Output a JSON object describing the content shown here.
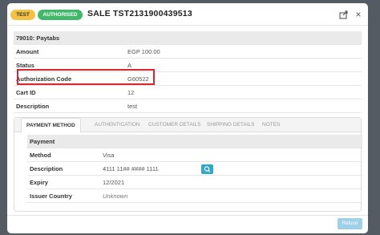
{
  "header": {
    "badge_test": "TEST",
    "badge_status": "AUTHORISED",
    "title": "SALE  TST2131900439513",
    "share_icon": "share-icon",
    "close_icon": "close-icon"
  },
  "details": {
    "heading": "79010: Paytabs",
    "rows": [
      {
        "key": "Amount",
        "value": "EGP 100.00"
      },
      {
        "key": "Status",
        "value": "A"
      },
      {
        "key": "Authorization Code",
        "value": "G60522"
      },
      {
        "key": "Cart ID",
        "value": "12"
      },
      {
        "key": "Description",
        "value": "test"
      }
    ]
  },
  "tabs": [
    {
      "label": "PAYMENT METHOD",
      "active": true
    },
    {
      "label": "AUTHENTICATION",
      "active": false
    },
    {
      "label": "CUSTOMER DETAILS",
      "active": false
    },
    {
      "label": "SHIPPING DETAILS",
      "active": false
    },
    {
      "label": "NOTES",
      "active": false
    }
  ],
  "payment": {
    "heading": "Payment",
    "rows": [
      {
        "key": "Method",
        "value": "Visa"
      },
      {
        "key": "Description",
        "value": "4111 11## #### 1111"
      },
      {
        "key": "Expiry",
        "value": "12/2021"
      },
      {
        "key": "Issuer Country",
        "value": "Unknown"
      }
    ],
    "search_icon": "search-icon"
  },
  "footer": {
    "refund_label": "Refund"
  },
  "colors": {
    "test_badge": "#f3c244",
    "authorised_badge": "#41b86a",
    "highlight": "#d9262c",
    "accent": "#31a8c8",
    "refund_button": "#9fd0e7"
  }
}
